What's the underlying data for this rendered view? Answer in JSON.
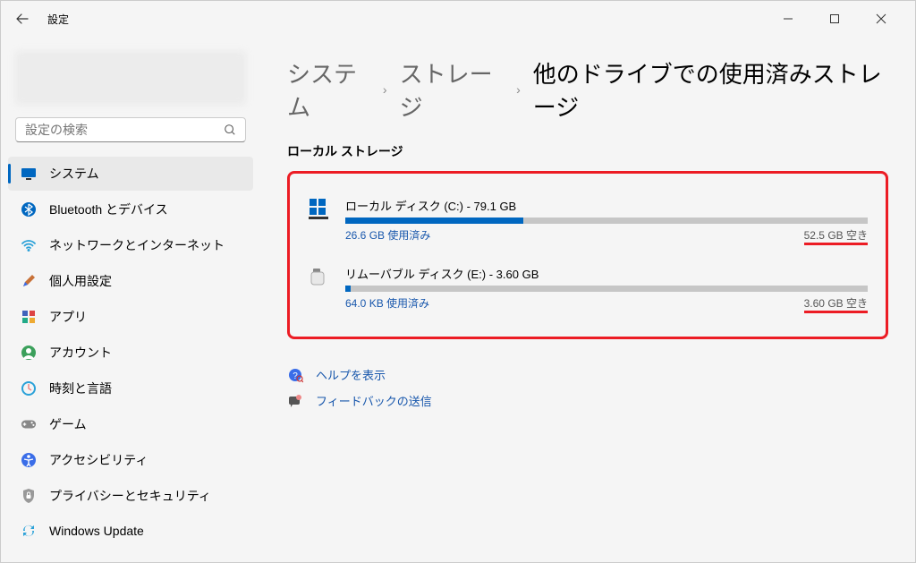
{
  "title": "設定",
  "search_placeholder": "設定の検索",
  "sidebar": {
    "items": [
      {
        "label": "システム"
      },
      {
        "label": "Bluetooth とデバイス"
      },
      {
        "label": "ネットワークとインターネット"
      },
      {
        "label": "個人用設定"
      },
      {
        "label": "アプリ"
      },
      {
        "label": "アカウント"
      },
      {
        "label": "時刻と言語"
      },
      {
        "label": "ゲーム"
      },
      {
        "label": "アクセシビリティ"
      },
      {
        "label": "プライバシーとセキュリティ"
      },
      {
        "label": "Windows Update"
      }
    ]
  },
  "breadcrumb": {
    "parent1": "システム",
    "parent2": "ストレージ",
    "current": "他のドライブでの使用済みストレージ"
  },
  "section_title": "ローカル ストレージ",
  "drives": [
    {
      "title": "ローカル ディスク (C:) - 79.1 GB",
      "used": "26.6 GB 使用済み",
      "free": "52.5 GB 空き",
      "fill_pct": 34
    },
    {
      "title": "リムーバブル ディスク (E:) - 3.60 GB",
      "used": "64.0 KB 使用済み",
      "free": "3.60 GB 空き",
      "fill_pct": 1
    }
  ],
  "help": {
    "show": "ヘルプを表示",
    "feedback": "フィードバックの送信"
  }
}
